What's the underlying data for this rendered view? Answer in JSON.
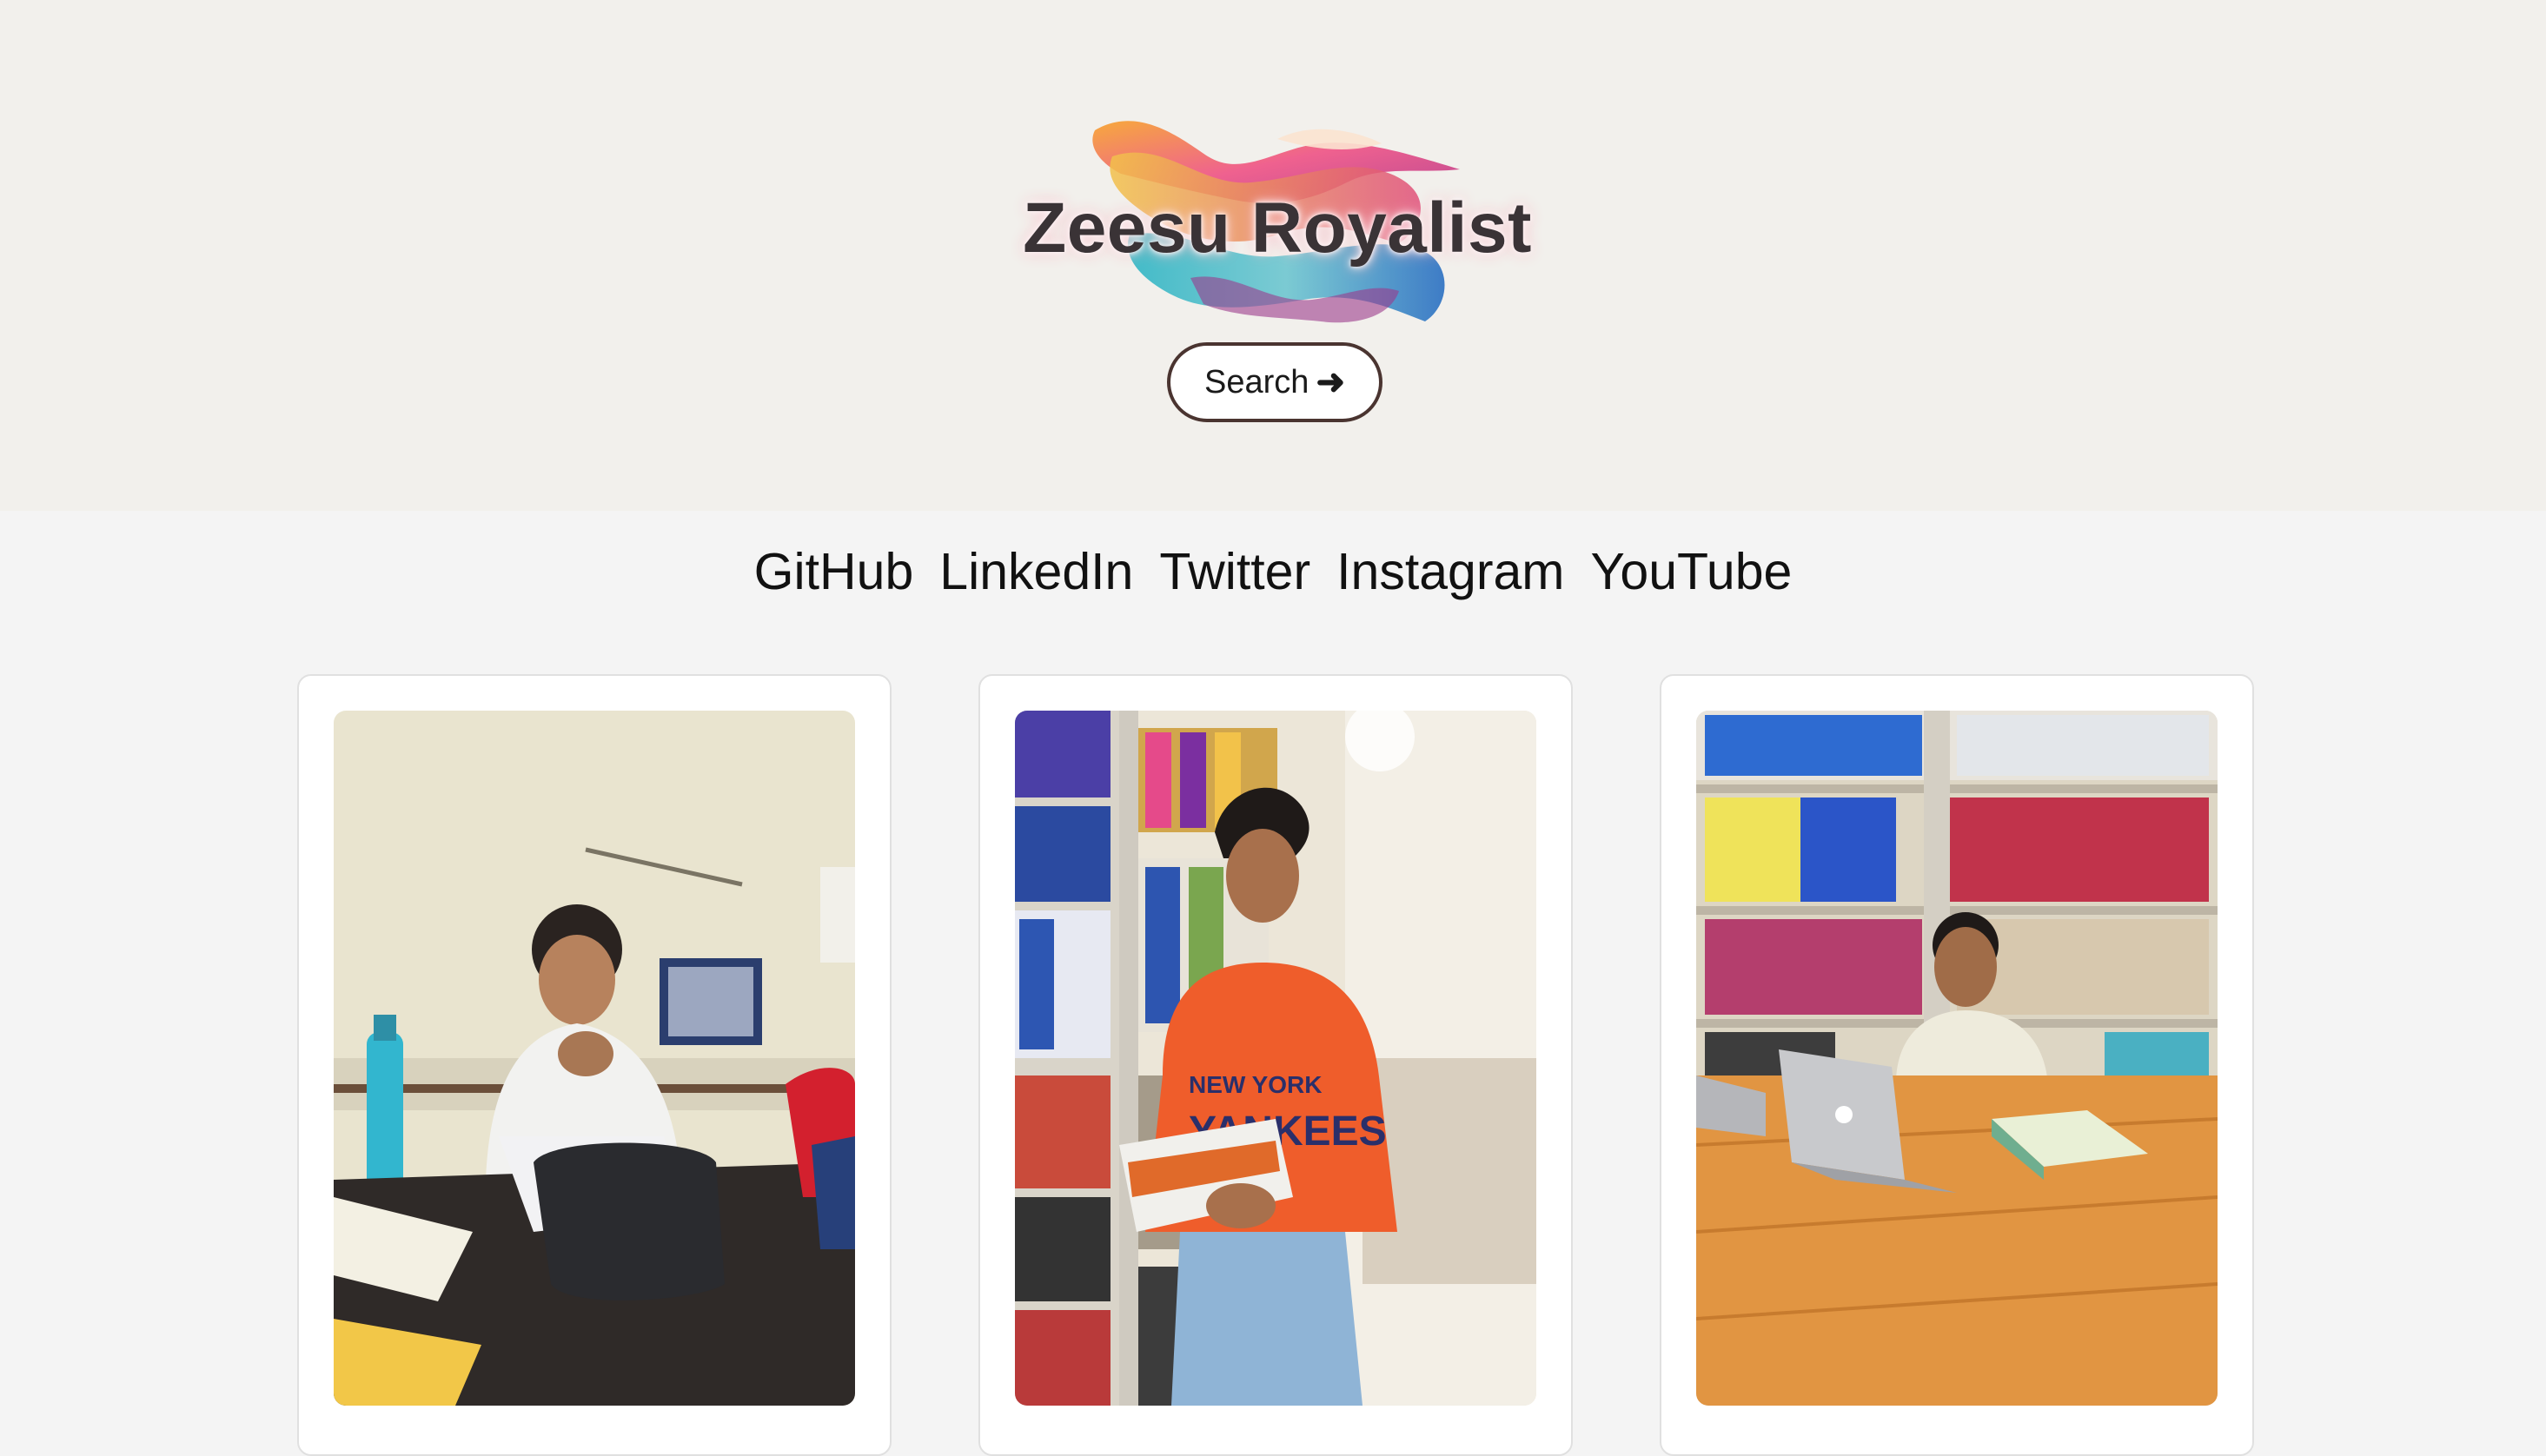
{
  "hero": {
    "logo_text": "Zeesu Royalist",
    "search_label": "Search",
    "search_arrow": "➜"
  },
  "social": {
    "links": [
      "GitHub",
      "LinkedIn",
      "Twitter",
      "Instagram",
      "YouTube"
    ]
  },
  "gallery": {
    "photos": [
      {
        "scene": "student-at-classroom-desk-photo"
      },
      {
        "scene": "student-in-library-aisle-photo"
      },
      {
        "scene": "student-at-library-table-with-laptop-photo"
      }
    ]
  }
}
